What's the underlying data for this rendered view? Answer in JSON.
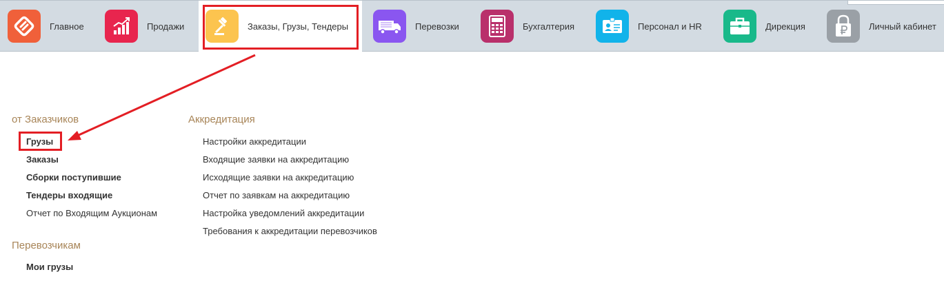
{
  "nav": {
    "items": [
      {
        "label": "Главное",
        "icon": "logo-icon",
        "color": "#f0603a"
      },
      {
        "label": "Продажи",
        "icon": "sales-chart-icon",
        "color": "#e8254e"
      },
      {
        "label": "Заказы,  Грузы, Тендеры",
        "icon": "gavel-icon",
        "color": "#fcc44f"
      },
      {
        "label": "Перевозки",
        "icon": "truck-icon",
        "color": "#8a56f0"
      },
      {
        "label": "Бухгалтерия",
        "icon": "calculator-icon",
        "color": "#b9306b"
      },
      {
        "label": "Персонал и HR",
        "icon": "id-card-icon",
        "color": "#11b3ea"
      },
      {
        "label": "Дирекция",
        "icon": "briefcase-icon",
        "color": "#19b98a"
      },
      {
        "label": "Личный кабинет",
        "icon": "ruble-lock-icon",
        "color": "#9aa0a6"
      }
    ],
    "active_index": 2
  },
  "sections": {
    "customers": {
      "title": "от Заказчиков",
      "links": [
        "Грузы",
        "Заказы",
        "Сборки поступившие",
        "Тендеры входящие",
        "Отчет по Входящим Аукционам"
      ]
    },
    "carriers": {
      "title": "Перевозчикам",
      "links": [
        "Мои грузы"
      ]
    },
    "accreditation": {
      "title": "Аккредитация",
      "links": [
        "Настройки аккредитации",
        "Входящие заявки на аккредитацию",
        "Исходящие заявки на аккредитацию",
        "Отчет по заявкам на аккредитацию",
        "Настройка уведомлений аккредитации",
        "Требования к аккредитации перевозчиков"
      ]
    }
  },
  "colors": {
    "annotation_red": "#e31e24",
    "section_title": "#a88558",
    "topbar_bg": "#d3dbe2"
  }
}
